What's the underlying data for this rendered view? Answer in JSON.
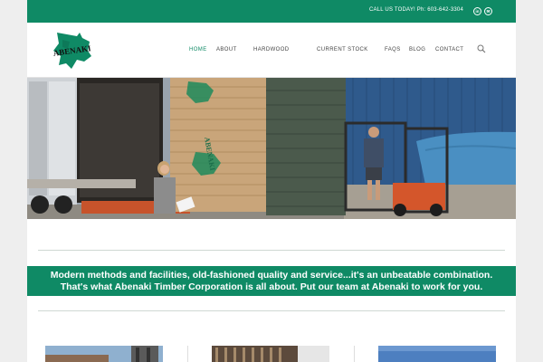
{
  "topbar": {
    "call_text": "CALL US TODAY! Ph: 603-642-3304",
    "social": [
      {
        "icon": "linkedin-icon",
        "glyph": "in"
      },
      {
        "icon": "email-icon",
        "glyph": "✉"
      }
    ]
  },
  "brand": {
    "logo_text": "ABENAKI",
    "colors": {
      "primary": "#0f8a65",
      "text": "#444444"
    }
  },
  "nav": {
    "items": [
      {
        "label": "HOME",
        "active": true
      },
      {
        "label": "ABOUT"
      },
      {
        "label": "HARDWOOD"
      },
      {
        "label": "CURRENT STOCK"
      },
      {
        "label": "FAQS"
      },
      {
        "label": "BLOG"
      },
      {
        "label": "CONTACT"
      }
    ],
    "search_icon": "search-icon"
  },
  "hero": {
    "stamp_text": "ABENAKI"
  },
  "band": {
    "line1": "Modern methods and facilities, old-fashioned quality and service...it's an unbeatable combination.",
    "line2": "That's what Abenaki Timber Corporation is all about. Put our team at Abenaki to work for you."
  }
}
